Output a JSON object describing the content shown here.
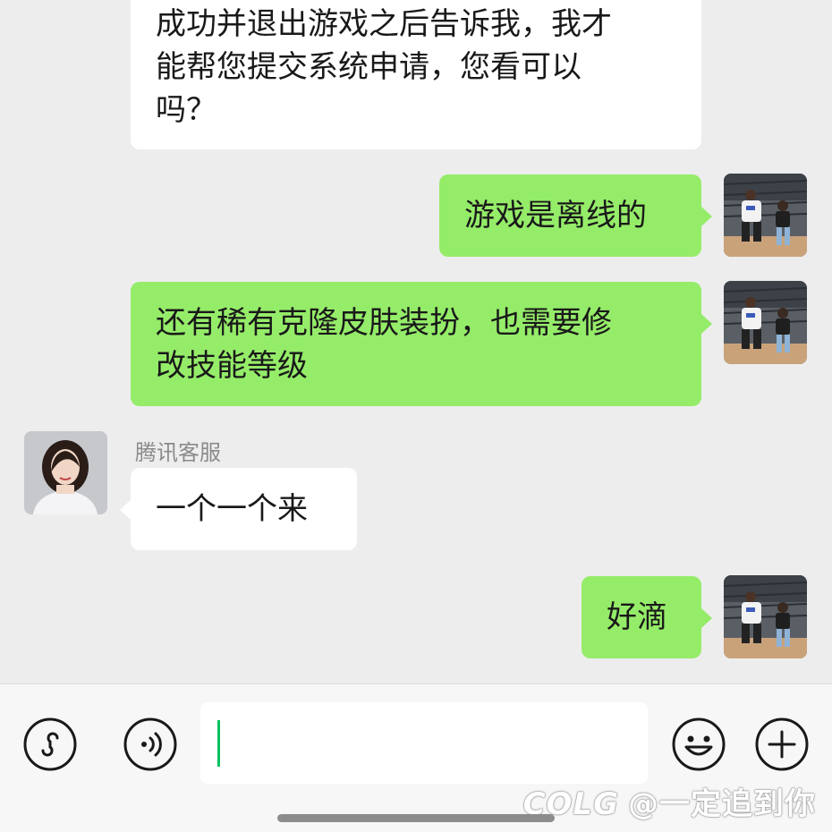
{
  "messages": [
    {
      "side": "left",
      "text": "成功并退出游戏之后告诉我，我才\n能帮您提交系统申请，您看可以\n吗？"
    },
    {
      "side": "right",
      "text": "游戏是离线的"
    },
    {
      "side": "right",
      "text": "还有稀有克隆皮肤装扮，也需要修\n改技能等级"
    },
    {
      "side": "left",
      "sender": "腾讯客服",
      "text": "一个一个来"
    },
    {
      "side": "right",
      "text": "好滴"
    }
  ],
  "input": {
    "value": ""
  },
  "icons": {
    "mini_program": "link-loop-icon",
    "voice": "voice-icon",
    "emoji": "emoji-icon",
    "more": "plus-icon"
  },
  "watermark": "@一定追到你",
  "watermark_logo": "COLG",
  "colors": {
    "background": "#ededed",
    "self_bubble": "#95ec69",
    "other_bubble": "#ffffff",
    "caret": "#07c160"
  }
}
